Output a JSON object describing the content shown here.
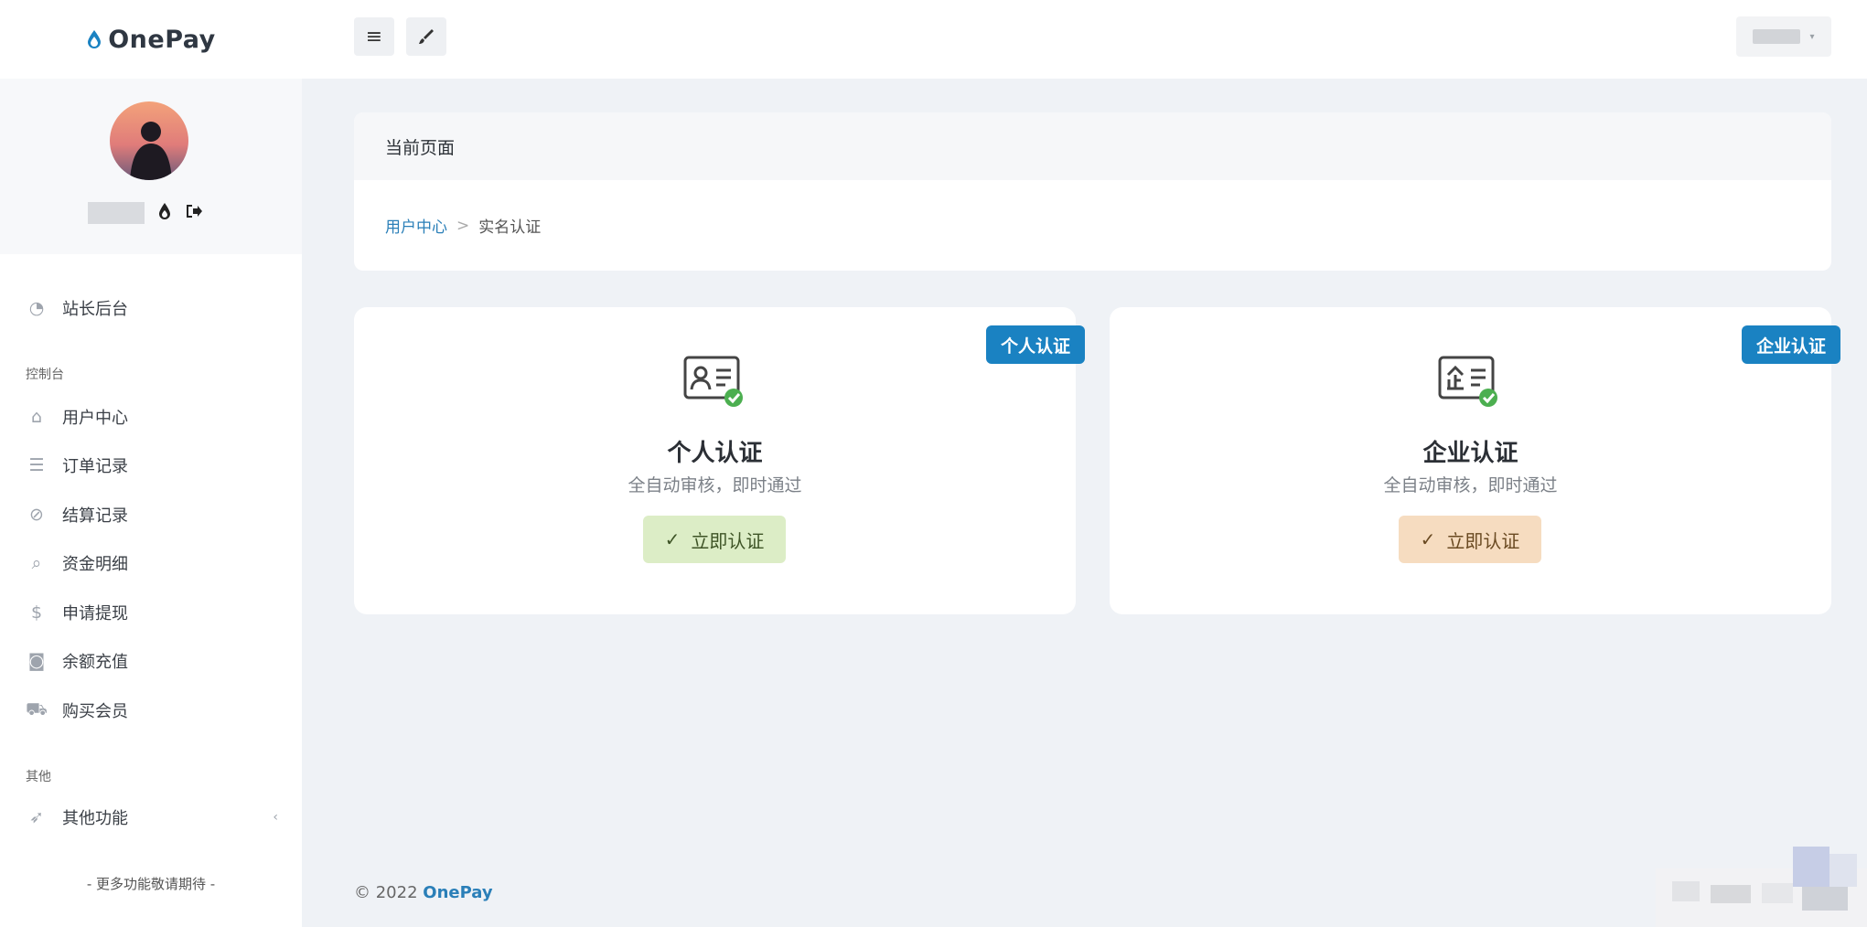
{
  "brand": {
    "name": "OnePay",
    "accent": "#1a82c2"
  },
  "toolbar": {
    "menu_icon": "menu-icon",
    "theme_icon": "brush-icon"
  },
  "sidebar": {
    "items_top": [
      {
        "label": "站长后台",
        "icon": "dashboard-icon"
      }
    ],
    "group_console": "控制台",
    "items_console": [
      {
        "label": "用户中心",
        "icon": "home-icon"
      },
      {
        "label": "订单记录",
        "icon": "list-icon"
      },
      {
        "label": "结算记录",
        "icon": "check-circle-icon"
      },
      {
        "label": "资金明细",
        "icon": "search-icon"
      },
      {
        "label": "申请提现",
        "icon": "dollar-icon"
      },
      {
        "label": "余额充值",
        "icon": "user-coin-icon"
      },
      {
        "label": "购买会员",
        "icon": "cart-icon"
      }
    ],
    "group_other": "其他",
    "items_other": [
      {
        "label": "其他功能",
        "icon": "rocket-icon"
      }
    ],
    "more_note": "- 更多功能敬请期待 -"
  },
  "breadcrumb": {
    "heading": "当前页面",
    "link": "用户中心",
    "separator": ">",
    "current": "实名认证"
  },
  "cards": [
    {
      "badge": "个人认证",
      "title": "个人认证",
      "subtitle": "全自动审核，即时通过",
      "button": "立即认证",
      "button_color": "#dcedc6",
      "icon": "person-id-card-icon"
    },
    {
      "badge": "企业认证",
      "title": "企业认证",
      "subtitle": "全自动审核，即时通过",
      "button": "立即认证",
      "button_color": "#f6dcc0",
      "icon": "enterprise-id-card-icon"
    }
  ],
  "footer": {
    "copyright": "© 2022",
    "brand": "OnePay"
  }
}
